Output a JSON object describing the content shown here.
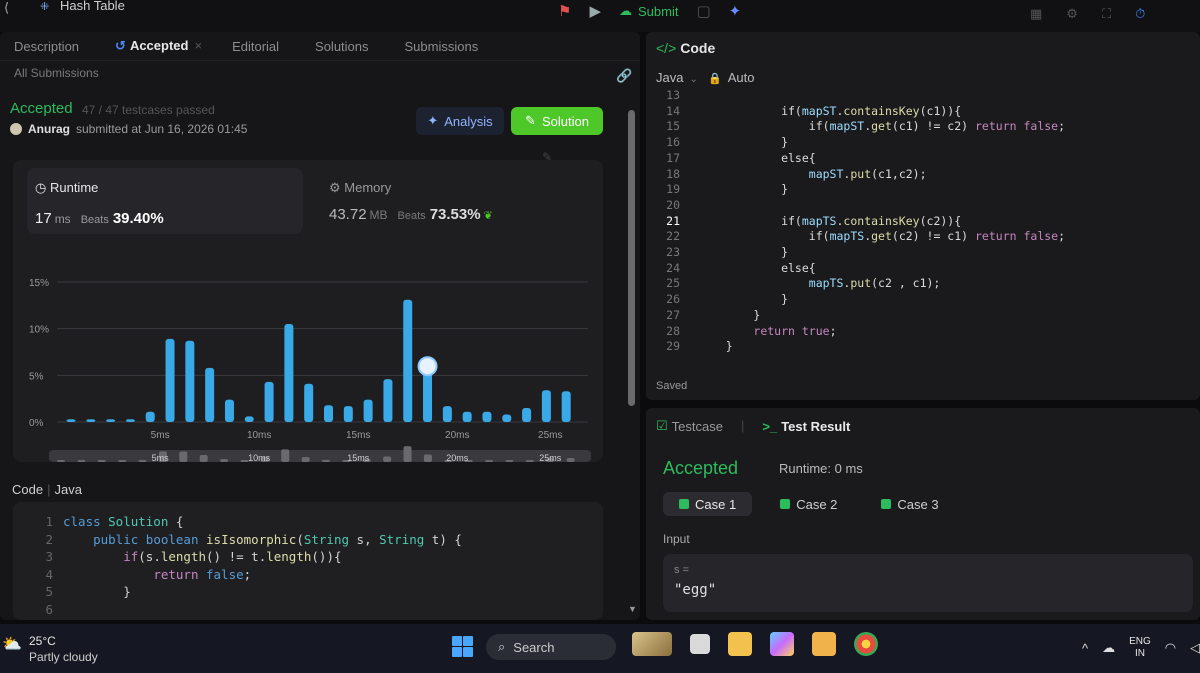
{
  "topbar": {
    "problem_title": "Hash Table",
    "submit_label": "Submit"
  },
  "left": {
    "tabs": [
      {
        "label": "Description"
      },
      {
        "label": "Accepted"
      },
      {
        "label": "Editorial"
      },
      {
        "label": "Solutions"
      },
      {
        "label": "Submissions"
      }
    ],
    "all_submissions": "All Submissions",
    "status": "Accepted",
    "testcases": "47 / 47 testcases passed",
    "submitter": "Anurag",
    "submitted_at": "submitted at Jun 16, 2026 01:45",
    "analysis_label": "Analysis",
    "solution_label": "Solution",
    "runtime": {
      "label": "Runtime",
      "value": "17",
      "unit": "ms",
      "beats_label": "Beats",
      "beats": "39.40%"
    },
    "memory": {
      "label": "Memory",
      "value": "43.72",
      "unit": "MB",
      "beats_label": "Beats",
      "beats": "73.53%"
    },
    "code_title": "Code",
    "code_lang": "Java",
    "code_lines": [
      {
        "n": "1",
        "tokens": [
          [
            "kw2",
            "class "
          ],
          [
            "ty",
            "Solution"
          ],
          [
            "tx",
            " {"
          ]
        ]
      },
      {
        "n": "2",
        "tokens": [
          [
            "tx",
            "    "
          ],
          [
            "kw2",
            "public "
          ],
          [
            "kw2",
            "boolean "
          ],
          [
            "fn",
            "isIsomorphic"
          ],
          [
            "tx",
            "("
          ],
          [
            "ty",
            "String"
          ],
          [
            "tx",
            " s, "
          ],
          [
            "ty",
            "String"
          ],
          [
            "tx",
            " t) {"
          ]
        ]
      },
      {
        "n": "3",
        "tokens": [
          [
            "tx",
            "        "
          ],
          [
            "kw",
            "if"
          ],
          [
            "tx",
            "(s."
          ],
          [
            "fn",
            "length"
          ],
          [
            "tx",
            "() != t."
          ],
          [
            "fn",
            "length"
          ],
          [
            "tx",
            "()){"
          ]
        ]
      },
      {
        "n": "4",
        "tokens": [
          [
            "tx",
            "            "
          ],
          [
            "kw",
            "return "
          ],
          [
            "kw2",
            "false"
          ],
          [
            "tx",
            ";"
          ]
        ]
      },
      {
        "n": "5",
        "tokens": [
          [
            "tx",
            "        }"
          ]
        ]
      },
      {
        "n": "6",
        "tokens": []
      }
    ]
  },
  "chart_data": {
    "type": "bar",
    "title": "",
    "xlabel": "",
    "ylabel": "",
    "ylim": [
      0,
      15
    ],
    "y_ticks": [
      "15%",
      "10%",
      "5%",
      "0%"
    ],
    "x_ticks": [
      "5ms",
      "10ms",
      "15ms",
      "20ms",
      "25ms"
    ],
    "highlight_index": 18,
    "values": [
      0.3,
      0.3,
      0.3,
      0.3,
      1.1,
      8.9,
      8.7,
      5.8,
      2.4,
      0.6,
      4.3,
      10.5,
      4.1,
      1.8,
      1.7,
      2.4,
      4.6,
      13.1,
      6.3,
      1.7,
      1.1,
      1.1,
      0.8,
      1.5,
      3.4,
      3.3
    ],
    "minimap_ticks": [
      "5ms",
      "10ms",
      "15ms",
      "20ms",
      "25ms"
    ],
    "grid": true,
    "colors": {
      "bar": "#39a9e8",
      "grid": "#3a3a3e",
      "axis_text": "#9a9a9a"
    }
  },
  "right": {
    "code_title": "Code",
    "language": "Java",
    "mode": "Auto",
    "saved": "Saved",
    "editor_lines": [
      {
        "n": "13",
        "code": ""
      },
      {
        "n": "14",
        "code": "            if(mapST.containsKey(c1)){"
      },
      {
        "n": "15",
        "code": "                if(mapST.get(c1) != c2) return false;"
      },
      {
        "n": "16",
        "code": "            }"
      },
      {
        "n": "17",
        "code": "            else{"
      },
      {
        "n": "18",
        "code": "                mapST.put(c1,c2);"
      },
      {
        "n": "19",
        "code": "            }"
      },
      {
        "n": "20",
        "code": ""
      },
      {
        "n": "21",
        "code": "            if(mapTS.containsKey(c2)){"
      },
      {
        "n": "22",
        "code": "                if(mapTS.get(c2) != c1) return false;"
      },
      {
        "n": "23",
        "code": "            }"
      },
      {
        "n": "24",
        "code": "            else{"
      },
      {
        "n": "25",
        "code": "                mapTS.put(c2 , c1);"
      },
      {
        "n": "26",
        "code": "            }"
      },
      {
        "n": "27",
        "code": "        }"
      },
      {
        "n": "28",
        "code": "        return true;"
      },
      {
        "n": "29",
        "code": "    }"
      }
    ],
    "current_line": "21",
    "testcase_label": "Testcase",
    "testresult_label": "Test Result",
    "result_status": "Accepted",
    "result_runtime": "Runtime: 0 ms",
    "cases": [
      "Case 1",
      "Case 2",
      "Case 3"
    ],
    "input_label": "Input",
    "input_var": "s =",
    "input_value": "\"egg\""
  },
  "taskbar": {
    "temp": "25°C",
    "weather": "Partly cloudy",
    "search_label": "Search",
    "lang_line1": "ENG",
    "lang_line2": "IN"
  }
}
